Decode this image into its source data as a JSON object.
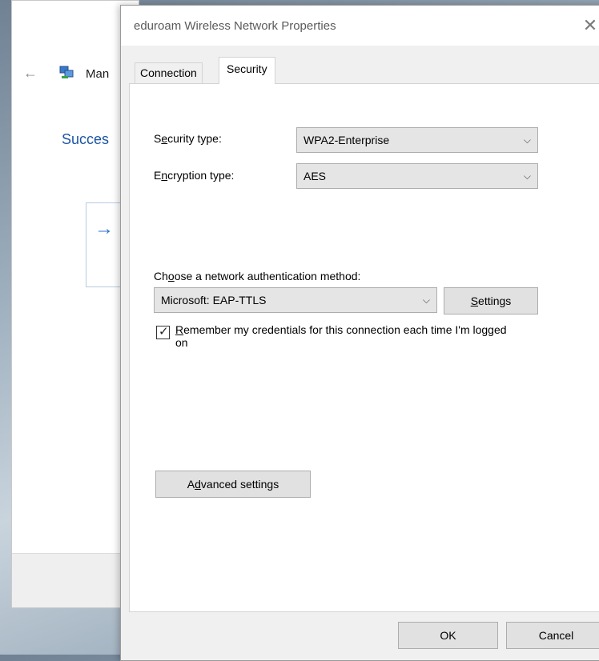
{
  "background_window": {
    "title_partial": "Man",
    "heading_partial": "Succes",
    "back_icon": "←",
    "arrow_icon": "→"
  },
  "dialog": {
    "title": "eduroam Wireless Network Properties",
    "close_icon": "✕",
    "tabs": [
      {
        "label": "Connection",
        "active": false
      },
      {
        "label": "Security",
        "active": true
      }
    ]
  },
  "security": {
    "security_type": {
      "label_pre": "S",
      "label_u": "e",
      "label_post": "curity type:",
      "value": "WPA2-Enterprise"
    },
    "encryption_type": {
      "label_pre": "E",
      "label_u": "n",
      "label_post": "cryption type:",
      "value": "AES"
    },
    "auth_method": {
      "label_pre": "Ch",
      "label_u": "o",
      "label_post": "ose a network authentication method:",
      "value": "Microsoft: EAP-TTLS"
    },
    "settings_button": {
      "u": "S",
      "rest": "ettings"
    },
    "remember": {
      "checked": true,
      "label_u": "R",
      "label_rest": "emember my credentials for this connection each time I'm logged on"
    },
    "advanced_button": {
      "pre": "A",
      "u": "d",
      "post": "vanced settings"
    }
  },
  "footer": {
    "ok_label": "OK",
    "cancel_label": "Cancel"
  },
  "icons": {
    "chevron": "⌵",
    "check": "✓"
  }
}
